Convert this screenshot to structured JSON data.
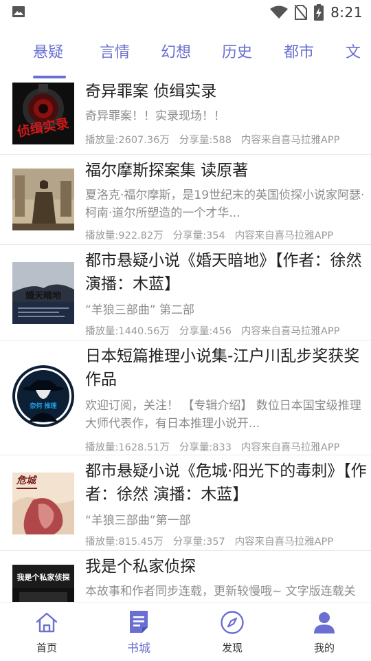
{
  "status_bar": {
    "time": "8:21",
    "icons": [
      "image-icon",
      "wifi-icon",
      "no-sim-icon",
      "battery-charging-icon"
    ]
  },
  "tabs": [
    {
      "label": "悬疑",
      "active": true
    },
    {
      "label": "言情",
      "active": false
    },
    {
      "label": "幻想",
      "active": false
    },
    {
      "label": "历史",
      "active": false
    },
    {
      "label": "都市",
      "active": false
    },
    {
      "label": "文",
      "active": false
    }
  ],
  "items": [
    {
      "title": "奇异罪案 侦缉实录",
      "desc": "奇异罪案！！实录现场！！",
      "plays": "播放量:2607.36万",
      "shares": "分享量:588",
      "source": "内容来自喜马拉雅APP",
      "cover_text": "侦缉实录"
    },
    {
      "title": "福尔摩斯探案集 读原著",
      "desc": "夏洛克·福尔摩斯，是19世纪末的英国侦探小说家阿瑟·柯南·道尔所塑造的一个才华...",
      "plays": "播放量:922.82万",
      "shares": "分享量:354",
      "source": "内容来自喜马拉雅APP",
      "cover_text": ""
    },
    {
      "title": "都市悬疑小说《婚天暗地》【作者：徐然 演播：木蓝】",
      "desc": "“羊狼三部曲” 第二部",
      "plays": "播放量:1440.56万",
      "shares": "分享量:456",
      "source": "内容来自喜马拉雅APP",
      "cover_text": "婚天暗地"
    },
    {
      "title": "日本短篇推理小说集-江户川乱步奖获奖作品",
      "desc": "欢迎订阅，关注！ 【专辑介绍】 数位日本国宝级推理大师代表作，有日本推理小说开...",
      "plays": "播放量:1628.51万",
      "shares": "分享量:833",
      "source": "内容来自喜马拉雅APP",
      "cover_text": ""
    },
    {
      "title": "都市悬疑小说《危城·阳光下的毒刺》【作者：徐然 演播：木蓝】",
      "desc": "“羊狼三部曲”第一部",
      "plays": "播放量:815.45万",
      "shares": "分享量:357",
      "source": "内容来自喜马拉雅APP",
      "cover_text": "危城"
    },
    {
      "title": "我是个私家侦探",
      "desc": "本故事和作者同步连载，更新较慢哦~ 文字版连载关",
      "plays": "",
      "shares": "",
      "source": "",
      "cover_text": "我是个私家侦探"
    }
  ],
  "bottom_nav": [
    {
      "label": "首页",
      "icon": "home-icon",
      "active": false
    },
    {
      "label": "书城",
      "icon": "book-icon",
      "active": true
    },
    {
      "label": "发现",
      "icon": "compass-icon",
      "active": false
    },
    {
      "label": "我的",
      "icon": "user-icon",
      "active": false
    }
  ],
  "colors": {
    "accent": "#6a6fd1",
    "text": "#222222",
    "muted": "#8c8c8c"
  }
}
